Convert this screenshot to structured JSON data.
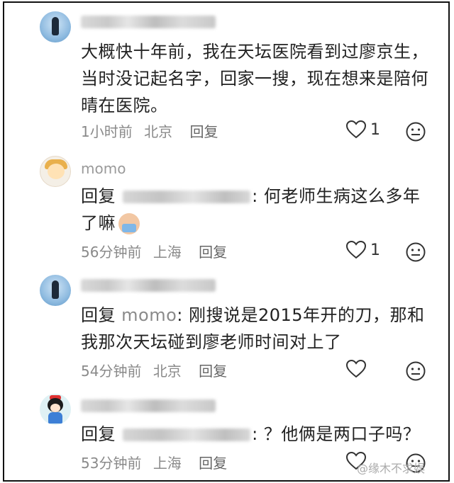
{
  "comments": [
    {
      "text": "大概快十年前，我在天坛医院看到过廖京生，当时没记起名字，回家一搜，现在想来是陪何晴在医院。",
      "time": "1小时前",
      "location": "北京",
      "reply_label": "回复",
      "likes": "1"
    },
    {
      "username": "momo",
      "reply_prefix": "回复",
      "text": ": 何老师生病这么多年了嘛",
      "time": "56分钟前",
      "location": "上海",
      "reply_label": "回复",
      "likes": "1"
    },
    {
      "reply_prefix": "回复",
      "reply_target": "momo",
      "text": ": 刚搜说是2015年开的刀，那和我那次天坛碰到廖老师时间对上了",
      "time": "54分钟前",
      "location": "北京",
      "reply_label": "回复",
      "likes": ""
    },
    {
      "reply_prefix": "回复",
      "text": ": ？他俩是两口子吗？",
      "time": "53分钟前",
      "location": "上海",
      "reply_label": "回复",
      "likes": ""
    }
  ],
  "watermark": "@缘木不求娱",
  "icons": {
    "like": "heart-outline-icon",
    "dislike": "neutral-face-icon"
  }
}
